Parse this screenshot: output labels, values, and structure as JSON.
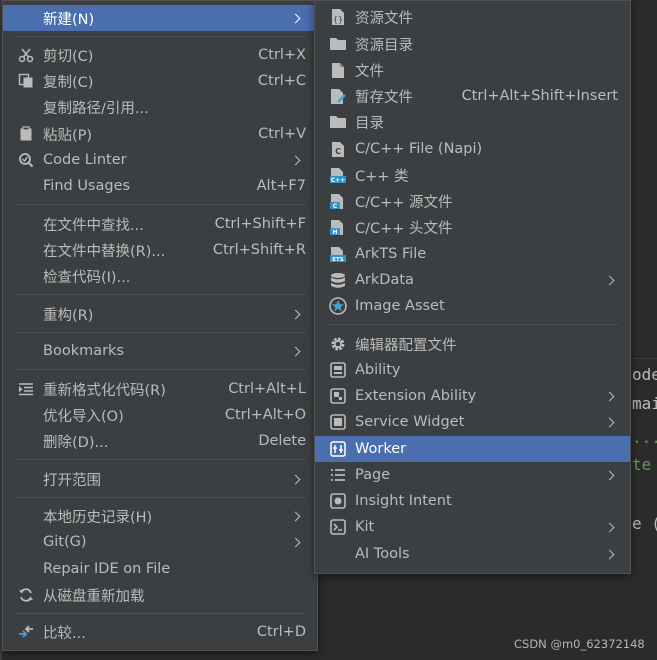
{
  "background": {
    "code_fragments": [
      "ode",
      "mai",
      "...",
      "te",
      "e ("
    ],
    "watermark": "CSDN @m0_62372148"
  },
  "main_menu": {
    "items": [
      {
        "label": "新建(N)",
        "shortcut": "",
        "icon": "",
        "submenu": true,
        "highlighted": true
      },
      {
        "label": "剪切(C)",
        "shortcut": "Ctrl+X",
        "icon": "scissors-icon",
        "submenu": false
      },
      {
        "label": "复制(C)",
        "shortcut": "Ctrl+C",
        "icon": "copy-icon",
        "submenu": false
      },
      {
        "label": "复制路径/引用...",
        "shortcut": "",
        "icon": "",
        "submenu": false
      },
      {
        "label": "粘贴(P)",
        "shortcut": "Ctrl+V",
        "icon": "clipboard-icon",
        "submenu": false
      },
      {
        "label": "Code Linter",
        "shortcut": "",
        "icon": "linter-icon",
        "submenu": true
      },
      {
        "label": "Find Usages",
        "shortcut": "Alt+F7",
        "icon": "",
        "submenu": false
      },
      {
        "label": "在文件中查找...",
        "shortcut": "Ctrl+Shift+F",
        "icon": "",
        "submenu": false
      },
      {
        "label": "在文件中替换(R)...",
        "shortcut": "Ctrl+Shift+R",
        "icon": "",
        "submenu": false
      },
      {
        "label": "检查代码(I)...",
        "shortcut": "",
        "icon": "",
        "submenu": false
      },
      {
        "label": "重构(R)",
        "shortcut": "",
        "icon": "",
        "submenu": true
      },
      {
        "label": "Bookmarks",
        "shortcut": "",
        "icon": "",
        "submenu": true
      },
      {
        "label": "重新格式化代码(R)",
        "shortcut": "Ctrl+Alt+L",
        "icon": "reformat-icon",
        "submenu": false
      },
      {
        "label": "优化导入(O)",
        "shortcut": "Ctrl+Alt+O",
        "icon": "",
        "submenu": false
      },
      {
        "label": "删除(D)...",
        "shortcut": "Delete",
        "icon": "",
        "submenu": false
      },
      {
        "label": "打开范围",
        "shortcut": "",
        "icon": "",
        "submenu": true
      },
      {
        "label": "本地历史记录(H)",
        "shortcut": "",
        "icon": "",
        "submenu": true
      },
      {
        "label": "Git(G)",
        "shortcut": "",
        "icon": "",
        "submenu": true
      },
      {
        "label": "Repair IDE on File",
        "shortcut": "",
        "icon": "",
        "submenu": false
      },
      {
        "label": "从磁盘重新加载",
        "shortcut": "",
        "icon": "reload-icon",
        "submenu": false
      },
      {
        "label": "比较...",
        "shortcut": "Ctrl+D",
        "icon": "compare-icon",
        "submenu": false
      }
    ]
  },
  "sub_menu": {
    "items": [
      {
        "label": "资源文件",
        "shortcut": "",
        "icon": "resource-file-icon",
        "submenu": false
      },
      {
        "label": "资源目录",
        "shortcut": "",
        "icon": "folder-icon",
        "submenu": false
      },
      {
        "label": "文件",
        "shortcut": "",
        "icon": "file-icon",
        "submenu": false
      },
      {
        "label": "暂存文件",
        "shortcut": "Ctrl+Alt+Shift+Insert",
        "icon": "scratch-file-icon",
        "submenu": false
      },
      {
        "label": "目录",
        "shortcut": "",
        "icon": "folder-icon",
        "submenu": false
      },
      {
        "label": "C/C++ File (Napi)",
        "shortcut": "",
        "icon": "c-file-icon",
        "submenu": false
      },
      {
        "label": "C++ 类",
        "shortcut": "",
        "icon": "cpp-class-icon",
        "submenu": false
      },
      {
        "label": "C/C++ 源文件",
        "shortcut": "",
        "icon": "c-source-icon",
        "submenu": false
      },
      {
        "label": "C/C++ 头文件",
        "shortcut": "",
        "icon": "c-header-icon",
        "submenu": false
      },
      {
        "label": "ArkTS File",
        "shortcut": "",
        "icon": "ets-file-icon",
        "submenu": false
      },
      {
        "label": "ArkData",
        "shortcut": "",
        "icon": "database-icon",
        "submenu": true
      },
      {
        "label": "Image Asset",
        "shortcut": "",
        "icon": "image-asset-icon",
        "submenu": false
      },
      {
        "label": "编辑器配置文件",
        "shortcut": "",
        "icon": "gear-icon",
        "submenu": false
      },
      {
        "label": "Ability",
        "shortcut": "",
        "icon": "ability-icon",
        "submenu": false
      },
      {
        "label": "Extension Ability",
        "shortcut": "",
        "icon": "extension-ability-icon",
        "submenu": true
      },
      {
        "label": "Service Widget",
        "shortcut": "",
        "icon": "widget-icon",
        "submenu": true
      },
      {
        "label": "Worker",
        "shortcut": "",
        "icon": "worker-icon",
        "submenu": false,
        "highlighted": true
      },
      {
        "label": "Page",
        "shortcut": "",
        "icon": "page-icon",
        "submenu": true
      },
      {
        "label": "Insight Intent",
        "shortcut": "",
        "icon": "insight-intent-icon",
        "submenu": false
      },
      {
        "label": "Kit",
        "shortcut": "",
        "icon": "kit-icon",
        "submenu": true
      },
      {
        "label": "AI Tools",
        "shortcut": "",
        "icon": "",
        "submenu": true
      }
    ]
  },
  "colors": {
    "menu_bg": "#3c3f41",
    "highlight": "#4b6eaf",
    "text": "#bbbbbb",
    "editor_bg": "#2b2b2b",
    "code_purple": "#9876aa",
    "code_green": "#629755"
  }
}
